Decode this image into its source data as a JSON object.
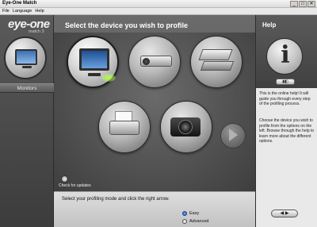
{
  "window": {
    "title": "Eye-One Match",
    "controls": [
      "_",
      "□",
      "✕"
    ]
  },
  "menu": [
    "File",
    "Language",
    "Help"
  ],
  "brand": {
    "logo": "eye-one",
    "sub": "match 3"
  },
  "left": {
    "section_label": "Monitors"
  },
  "main": {
    "heading": "Select the device you wish to profile",
    "devices": [
      "monitor-icon",
      "projector-icon",
      "scanner-icon",
      "printer-icon",
      "camera-icon"
    ],
    "updates_label": "Check for updates",
    "mode_prompt": "Select your profiling mode and click the right arrow.",
    "modes": [
      {
        "label": "Easy",
        "selected": true
      },
      {
        "label": "Advanced",
        "selected": false
      }
    ]
  },
  "help": {
    "title": "Help",
    "small_btn": "▮◧",
    "para1": "This is the online help! It will guide you through every step of the profiling process.",
    "para2": "Choose the device you wish to profile from the options on the left. Browse through the help to learn more about the different options."
  },
  "nav": {
    "forward_label": "◀ ▶"
  },
  "colors": {
    "accent_glow": "#b6ff4f",
    "radio_on": "#1f4ec4"
  }
}
